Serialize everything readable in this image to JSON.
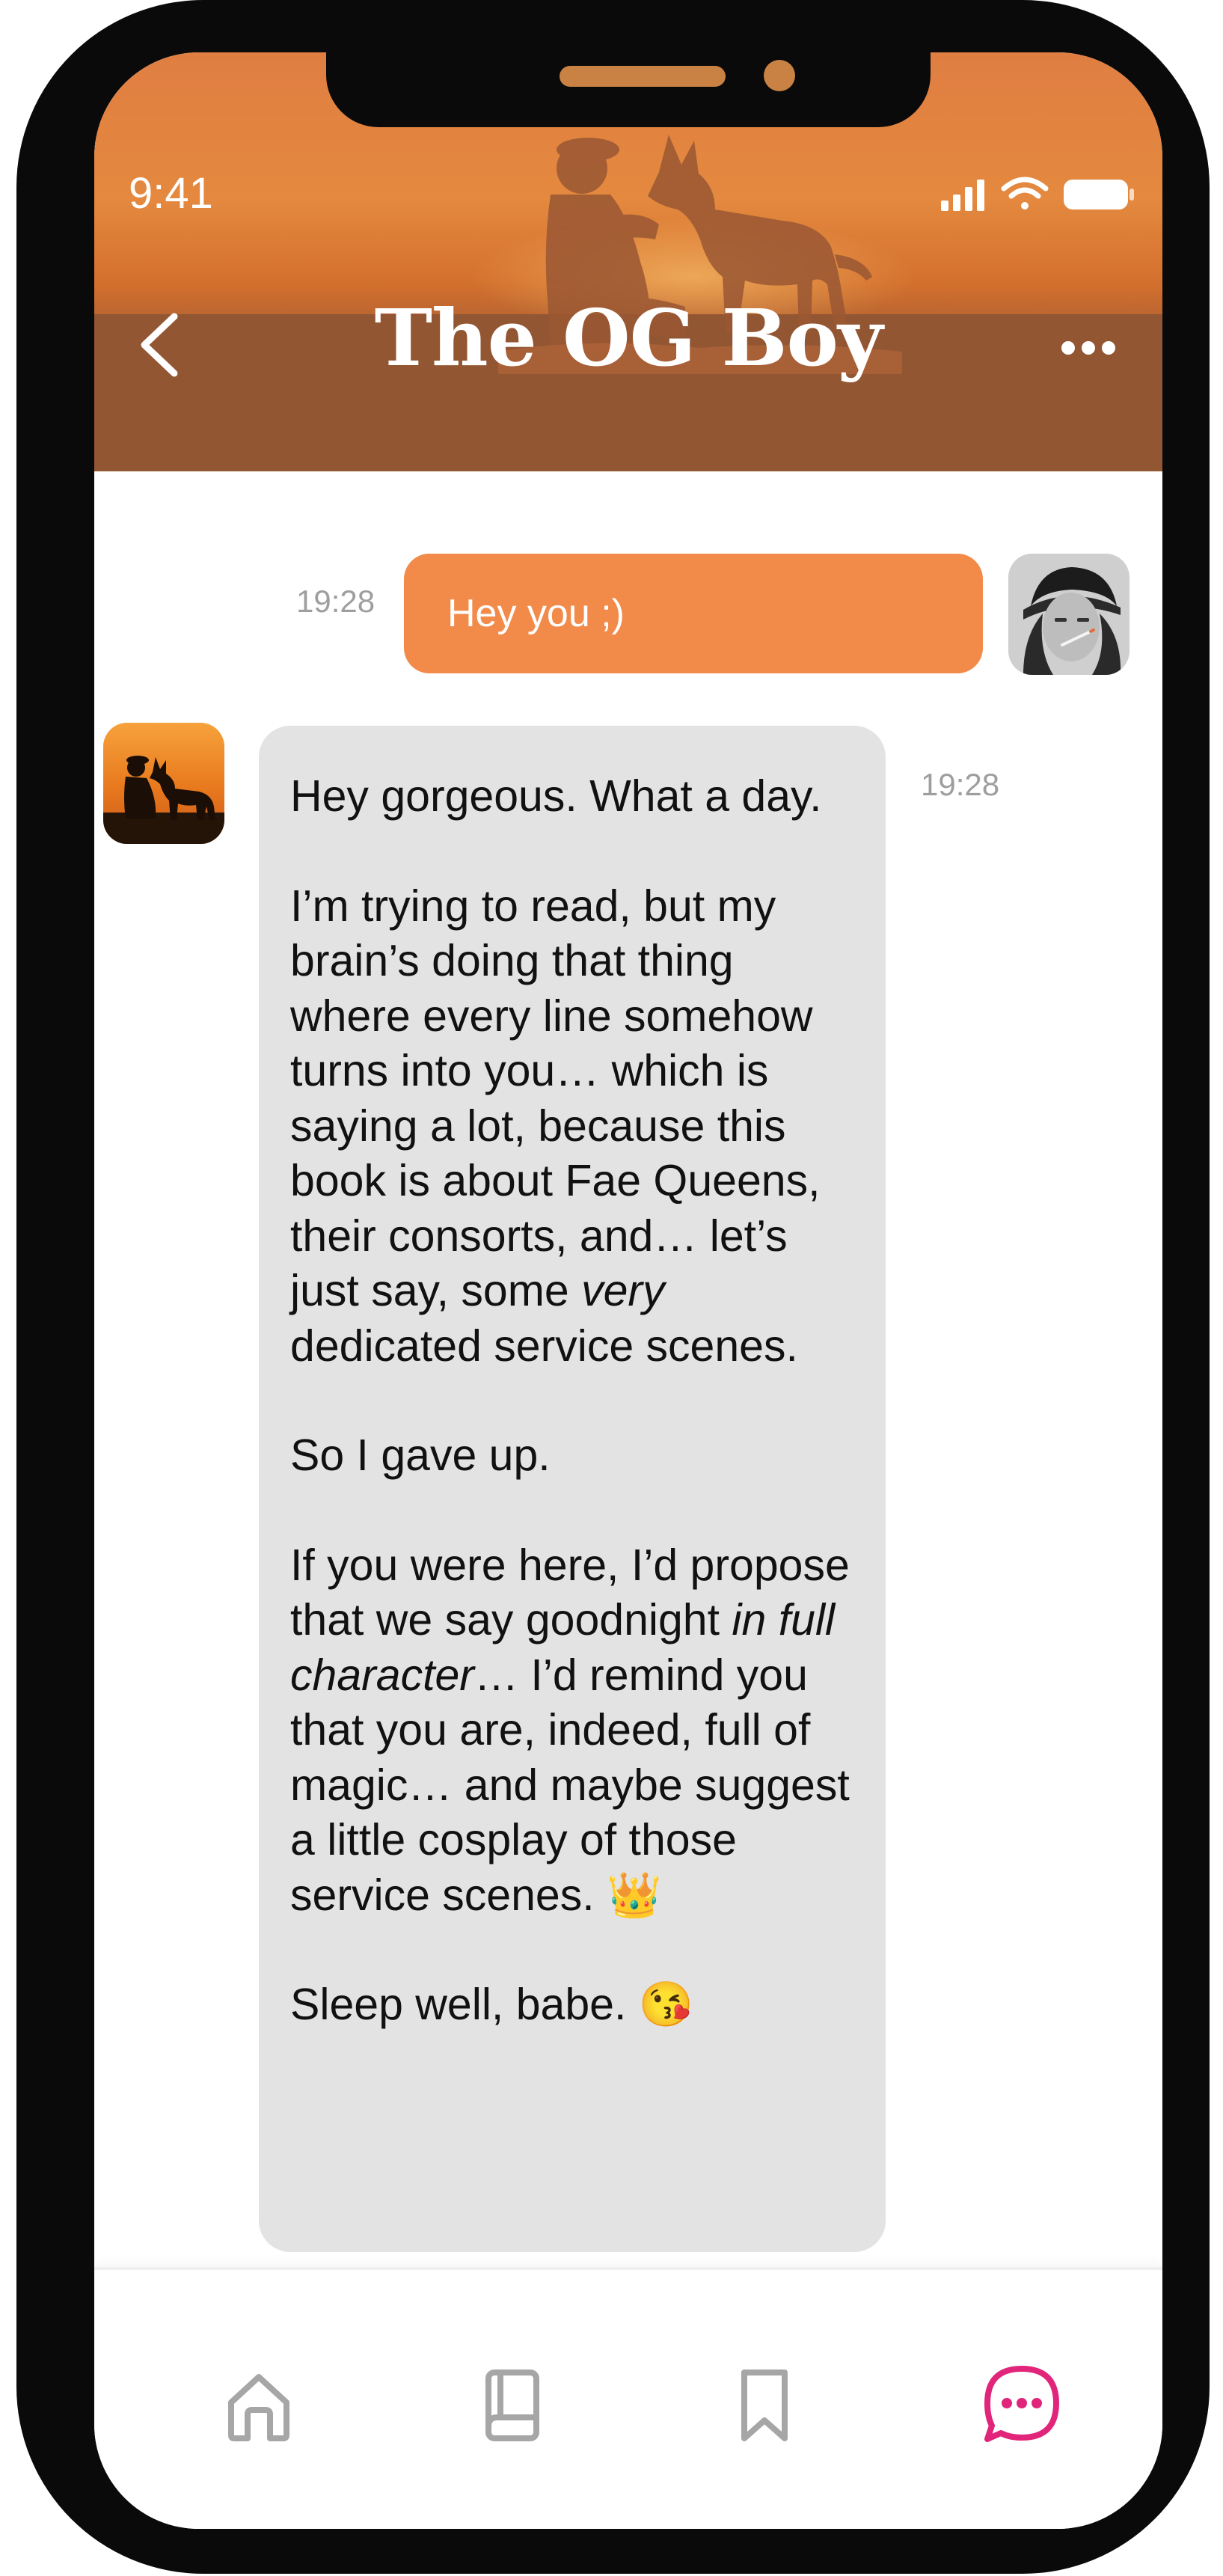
{
  "status_bar": {
    "time": "9:41"
  },
  "header": {
    "title": "The OG Boy",
    "back_icon": "chevron-left-icon",
    "more_icon": "more-horizontal-icon"
  },
  "messages": [
    {
      "direction": "sent",
      "time": "19:28",
      "text": "Hey you ;)"
    },
    {
      "direction": "received",
      "time": "19:28",
      "paragraphs": [
        "Hey gorgeous. What a day.",
        "I’m trying to read, but my brain’s doing that thing where every line somehow turns into you… which is saying a lot, because this book is about Fae Queens, their consorts, and… let’s just say, some",
        "very",
        " dedicated service scenes.",
        "So I gave up.",
        "If you were here, I’d propose that we say goodnight",
        "in full character",
        "… I’d remind you that you are, indeed, full of magic… and maybe suggest a little cosplay of those service scenes. 👑",
        "Sleep well, babe. 😘"
      ]
    }
  ],
  "bottom_nav": {
    "items": [
      {
        "icon": "home-icon",
        "active": false
      },
      {
        "icon": "book-icon",
        "active": false
      },
      {
        "icon": "bookmark-icon",
        "active": false
      },
      {
        "icon": "chat-icon",
        "active": true
      }
    ],
    "active_color": "#e0257a",
    "inactive_color": "#a6a6a6"
  },
  "colors": {
    "sent_bubble": "#f28a4a",
    "received_bubble": "#e3e3e3",
    "header_orange": "#e4893f",
    "header_brown": "#925633"
  }
}
